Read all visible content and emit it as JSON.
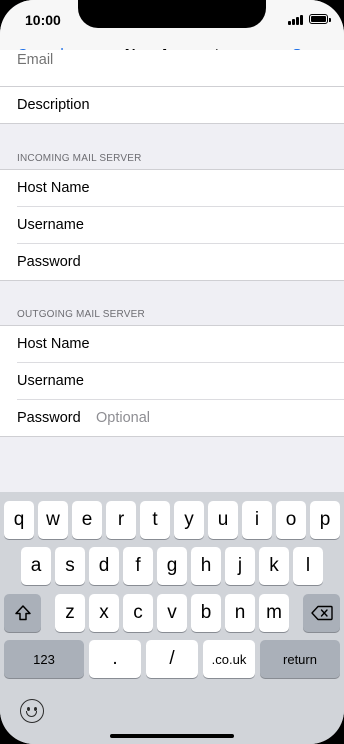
{
  "status_bar": {
    "time": "10:00"
  },
  "nav": {
    "cancel_label": "Cancel",
    "title": "New Account",
    "save_label": "Save"
  },
  "form": {
    "cut_off_label": "Email",
    "description_label": "Description",
    "incoming": {
      "header": "INCOMING MAIL SERVER",
      "host_label": "Host Name",
      "username_label": "Username",
      "password_label": "Password"
    },
    "outgoing": {
      "header": "OUTGOING MAIL SERVER",
      "host_label": "Host Name",
      "username_label": "Username",
      "password_label": "Password",
      "password_placeholder": "Optional"
    }
  },
  "keyboard": {
    "row1": [
      "q",
      "w",
      "e",
      "r",
      "t",
      "y",
      "u",
      "i",
      "o",
      "p"
    ],
    "row2": [
      "a",
      "s",
      "d",
      "f",
      "g",
      "h",
      "j",
      "k",
      "l"
    ],
    "row3": [
      "z",
      "x",
      "c",
      "v",
      "b",
      "n",
      "m"
    ],
    "numbers_label": "123",
    "dot_label": ".",
    "slash_label": "/",
    "domain_label": ".co.uk",
    "return_label": "return"
  },
  "icons": {
    "shift": "shift-icon",
    "delete": "delete-icon",
    "emoji": "emoji-icon",
    "signal": "signal-icon",
    "battery": "battery-icon"
  },
  "colors": {
    "accent": "#1a6ee8",
    "background": "#efeff4",
    "keyboard": "#d1d4d9"
  }
}
